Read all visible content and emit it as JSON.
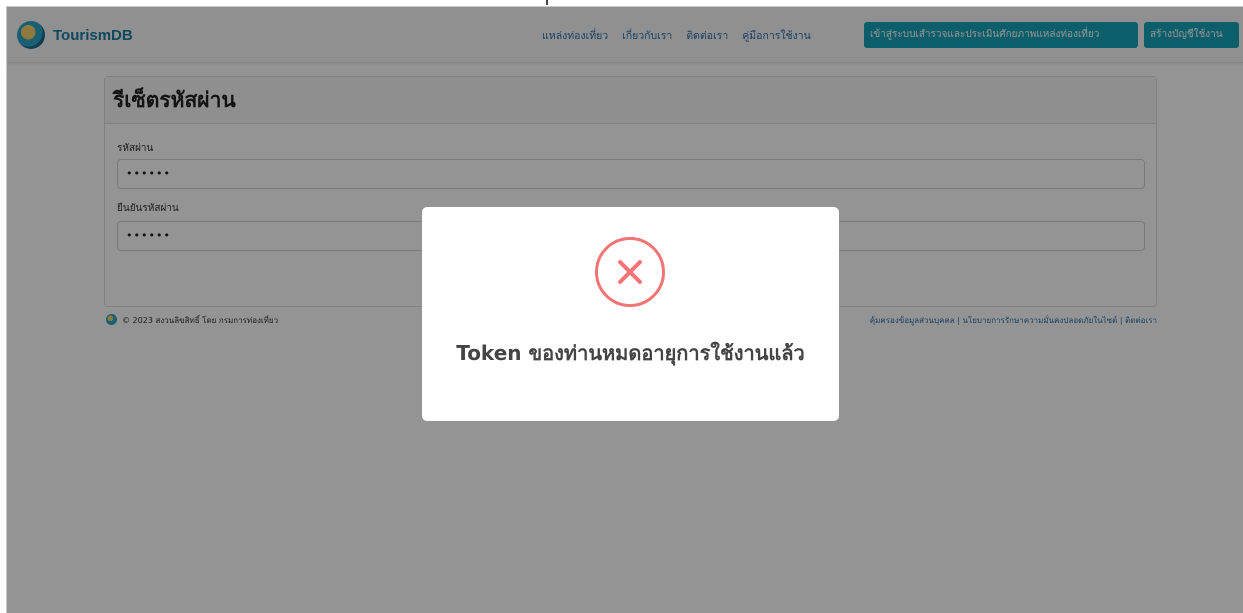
{
  "navbar": {
    "brand": "TourismDB",
    "links": [
      "แหล่งท่องเที่ยว",
      "เกี่ยวกับเรา",
      "ติดต่อเรา",
      "คู่มือการใช้งาน"
    ],
    "login_button": "เข้าสู่ระบบเสำรวจและประเมินศักยภาพแหล่งท่องเที่ยว",
    "register_button": "สร้างบัญชีใช้งาน"
  },
  "card": {
    "title": "รีเซ็ตรหัสผ่าน",
    "password_label": "รหัสผ่าน",
    "password_value": "••••••",
    "confirm_label": "ยืนยันรหัสผ่าน",
    "confirm_value": "••••••"
  },
  "footer": {
    "copyright": "© 2023 สงวนลิขสิทธิ์ โดย กรมการท่องเที่ยว",
    "links": "คุ้มครองข้อมูลส่วนบุคคล | นโยบายการรักษาความมั่นคงปลอดภัยในไซต์ | ติดต่อเรา"
  },
  "modal": {
    "icon": "error-x-icon",
    "message": "Token ของท่านหมดอายุการใช้งานแล้ว"
  },
  "colors": {
    "accent": "#17a2b8",
    "error": "#f27474",
    "link": "#2b6fae"
  }
}
